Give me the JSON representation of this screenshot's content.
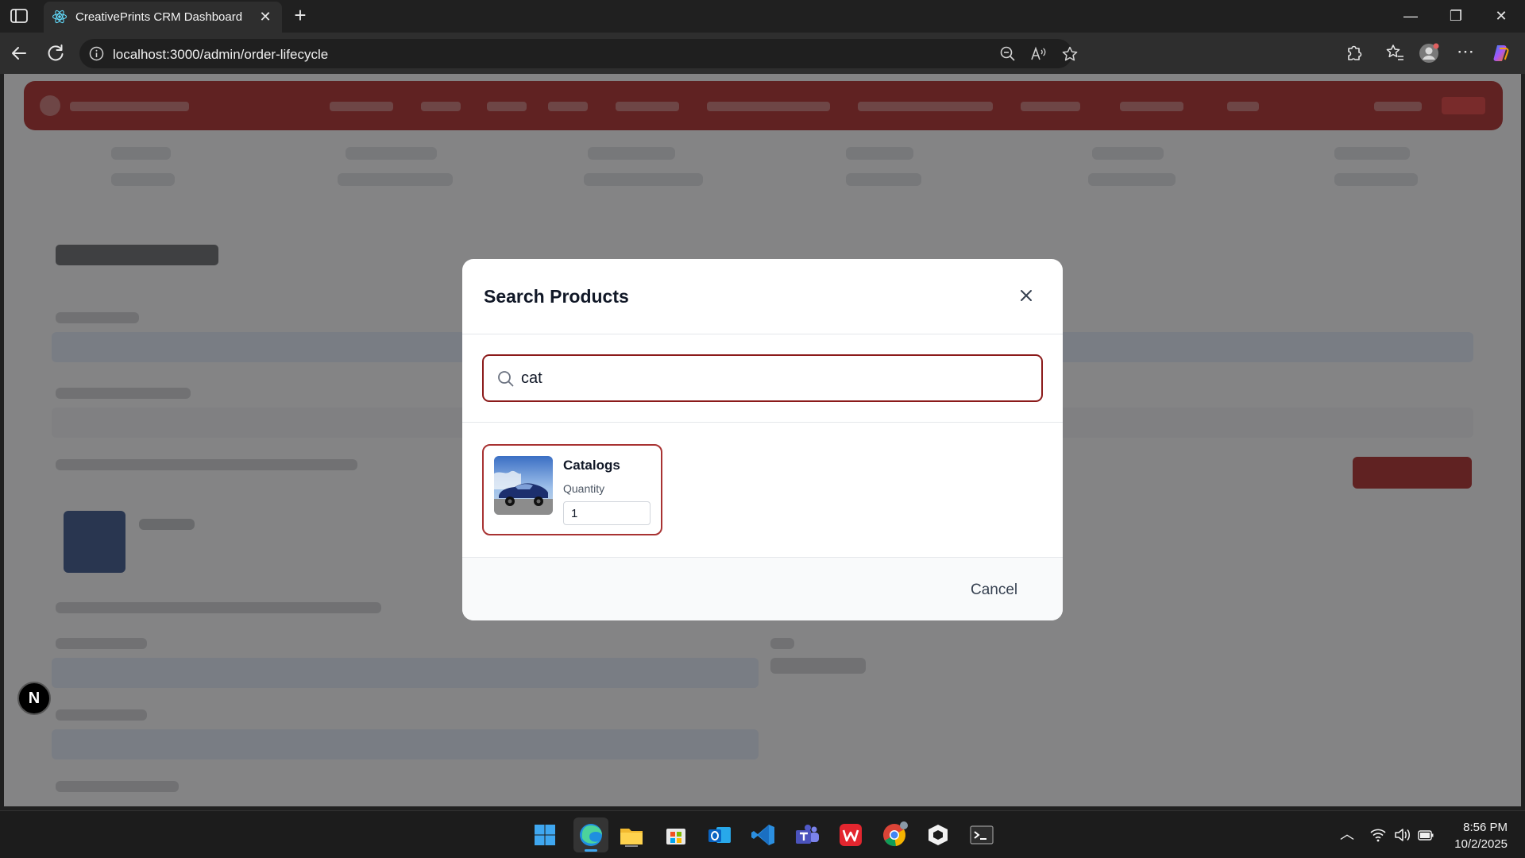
{
  "browser": {
    "tab_title": "CreativePrints CRM Dashboard",
    "url": "localhost:3000/admin/order-lifecycle"
  },
  "modal": {
    "title": "Search Products",
    "search_value": "cat",
    "results": [
      {
        "name": "Catalogs",
        "quantity_label": "Quantity",
        "quantity_value": "1"
      }
    ],
    "cancel_label": "Cancel"
  },
  "dev_badge": {
    "letter": "N"
  },
  "taskbar": {
    "apps": [
      "start-icon",
      "edge-icon",
      "file-explorer-icon",
      "store-icon",
      "outlook-icon",
      "vscode-icon",
      "teams-icon",
      "wps-icon",
      "chrome-icon",
      "app-icon",
      "terminal-icon"
    ],
    "clock_time": "8:56 PM",
    "clock_date": "10/2/2025"
  },
  "colors": {
    "brand_red": "#a51c1c",
    "accent_border": "#8b1a1a"
  }
}
